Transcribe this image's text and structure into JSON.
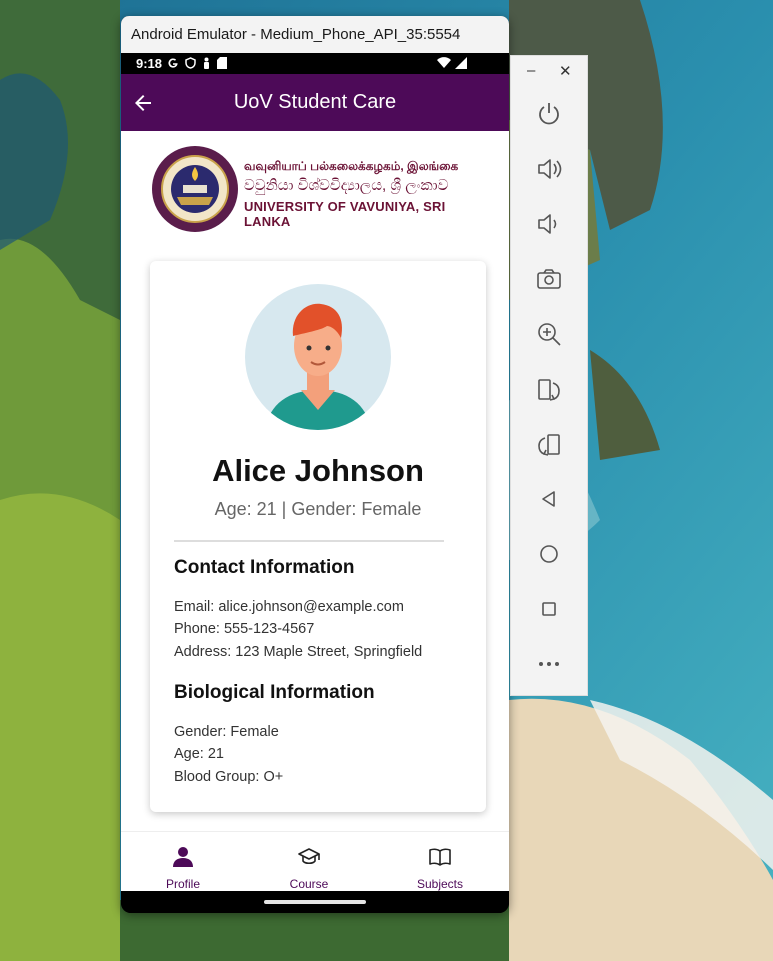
{
  "emulator": {
    "window_title": "Android Emulator - Medium_Phone_API_35:5554",
    "status_time": "9:18",
    "status_icons": [
      "google-g-icon",
      "shield-icon",
      "person-icon",
      "sd-card-icon"
    ],
    "status_right_icons": [
      "wifi-icon",
      "signal-icon"
    ],
    "toolbar_buttons": [
      "power",
      "volume-up",
      "volume-down",
      "camera",
      "zoom-in",
      "rotate-left",
      "rotate-right",
      "back",
      "home",
      "overview",
      "more"
    ]
  },
  "app": {
    "title": "UoV Student Care",
    "accent_color": "#4d0a58",
    "logo": {
      "line1": "வவுனியாப் பல்கலைக்கழகம், இலங்கை",
      "line2": "වවුනියා විශ්වවිද්‍යාලය, ශ්‍රී ලංකාව",
      "line3": "UNIVERSITY OF VAVUNIYA, SRI LANKA"
    }
  },
  "profile": {
    "name": "Alice Johnson",
    "summary": "Age: 21 | Gender: Female",
    "contact": {
      "title": "Contact Information",
      "email": "Email: alice.johnson@example.com",
      "phone": "Phone: 555-123-4567",
      "address": "Address: 123 Maple Street, Springfield"
    },
    "biological": {
      "title": "Biological Information",
      "gender": "Gender: Female",
      "age": "Age: 21",
      "blood_group": "Blood Group: O+"
    }
  },
  "bottom_nav": {
    "items": [
      {
        "label": "Profile",
        "icon": "person-icon",
        "active": true
      },
      {
        "label": "Course",
        "icon": "graduation-cap-icon",
        "active": false
      },
      {
        "label": "Subjects",
        "icon": "book-icon",
        "active": false
      }
    ],
    "active_color": "#4d0a58",
    "inactive_color": "#4d0a58"
  }
}
